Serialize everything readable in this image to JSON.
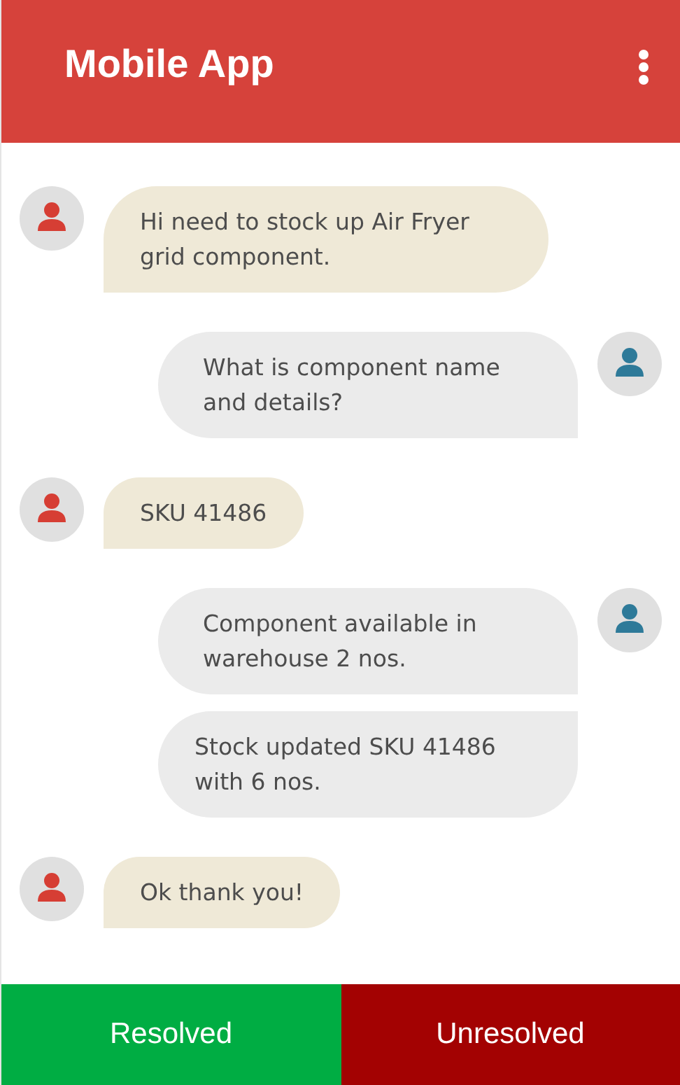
{
  "app_bar": {
    "title": "Mobile App"
  },
  "messages": [
    {
      "kind": "incoming",
      "show_avatar": true,
      "text": "Hi need to stock up Air Fryer grid component."
    },
    {
      "kind": "outgoing",
      "show_avatar": true,
      "text": "What is component name and details?"
    },
    {
      "kind": "incoming",
      "show_avatar": true,
      "text": "SKU 41486"
    },
    {
      "kind": "outgoing",
      "show_avatar": true,
      "text": "Component available in warehouse 2 nos."
    },
    {
      "kind": "outgoing",
      "show_avatar": false,
      "text": "Stock updated SKU 41486 with 6 nos."
    },
    {
      "kind": "incoming",
      "show_avatar": true,
      "text": "Ok thank you!"
    }
  ],
  "actions": [
    {
      "label": "Resolved",
      "color": "#00ad43"
    },
    {
      "label": "Unresolved",
      "color": "#a30202"
    }
  ]
}
